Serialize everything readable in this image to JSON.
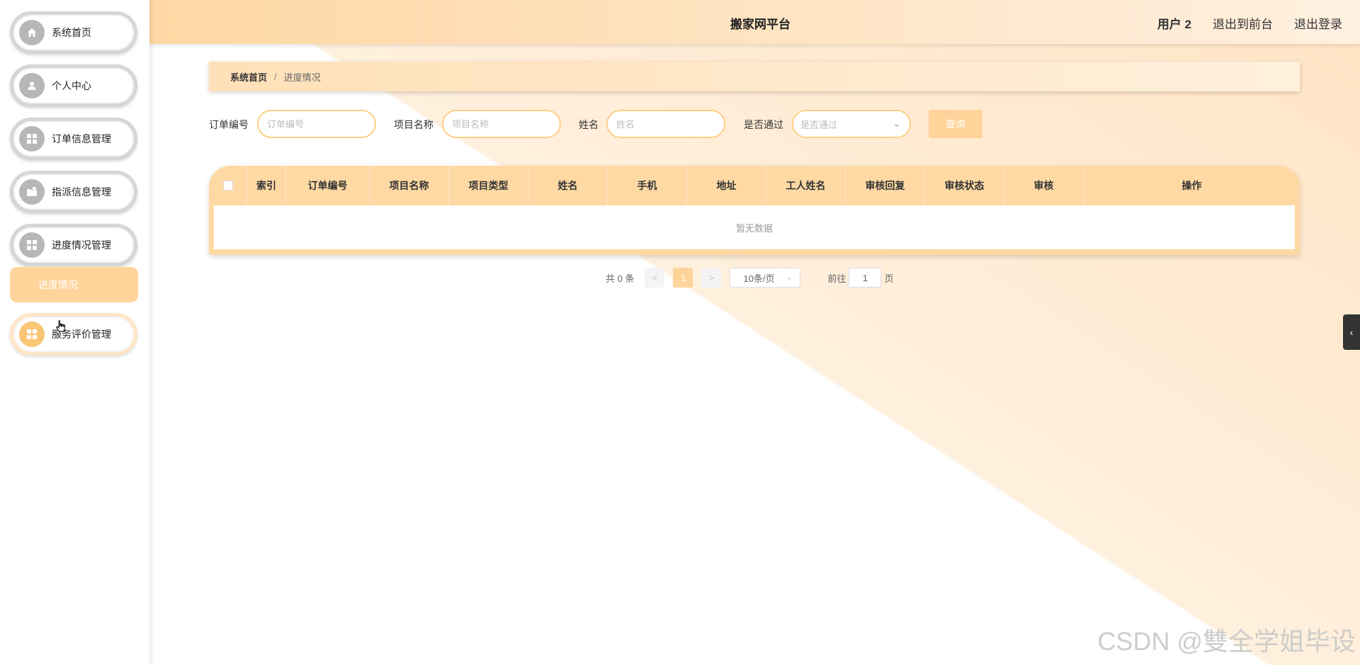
{
  "header": {
    "title": "搬家网平台",
    "user": "用户 2",
    "links": [
      "退出到前台",
      "退出登录"
    ]
  },
  "sidebar": {
    "items": [
      {
        "label": "系统首页",
        "icon": "home-icon"
      },
      {
        "label": "个人中心",
        "icon": "user-icon"
      },
      {
        "label": "订单信息管理",
        "icon": "grid-icon"
      },
      {
        "label": "指派信息管理",
        "icon": "folder-icon"
      },
      {
        "label": "进度情况管理",
        "icon": "grid-icon"
      },
      {
        "label": "服务评价管理",
        "icon": "grid-icon"
      }
    ],
    "submenu": "进度情况"
  },
  "breadcrumb": {
    "home": "系统首页",
    "separator": "/",
    "current": "进度情况"
  },
  "search": {
    "order_label": "订单编号",
    "order_placeholder": "订单编号",
    "project_label": "项目名称",
    "project_placeholder": "项目名称",
    "name_label": "姓名",
    "name_placeholder": "姓名",
    "pass_label": "是否通过",
    "pass_placeholder": "是否通过",
    "query_button": "查询"
  },
  "table": {
    "columns": [
      "索引",
      "订单编号",
      "项目名称",
      "项目类型",
      "姓名",
      "手机",
      "地址",
      "工人姓名",
      "审核回复",
      "审核状态",
      "审核",
      "操作"
    ],
    "empty_text": "暂无数据"
  },
  "pagination": {
    "total": "共 0 条",
    "prev": "<",
    "current_page": "1",
    "next": ">",
    "page_size": "10条/页",
    "goto_label": "前往",
    "goto_value": "1",
    "page_unit": "页"
  },
  "watermark": "CSDN @雙全学姐毕设",
  "colors": {
    "accent": "#ffd49b",
    "input_border": "#ffce86"
  }
}
